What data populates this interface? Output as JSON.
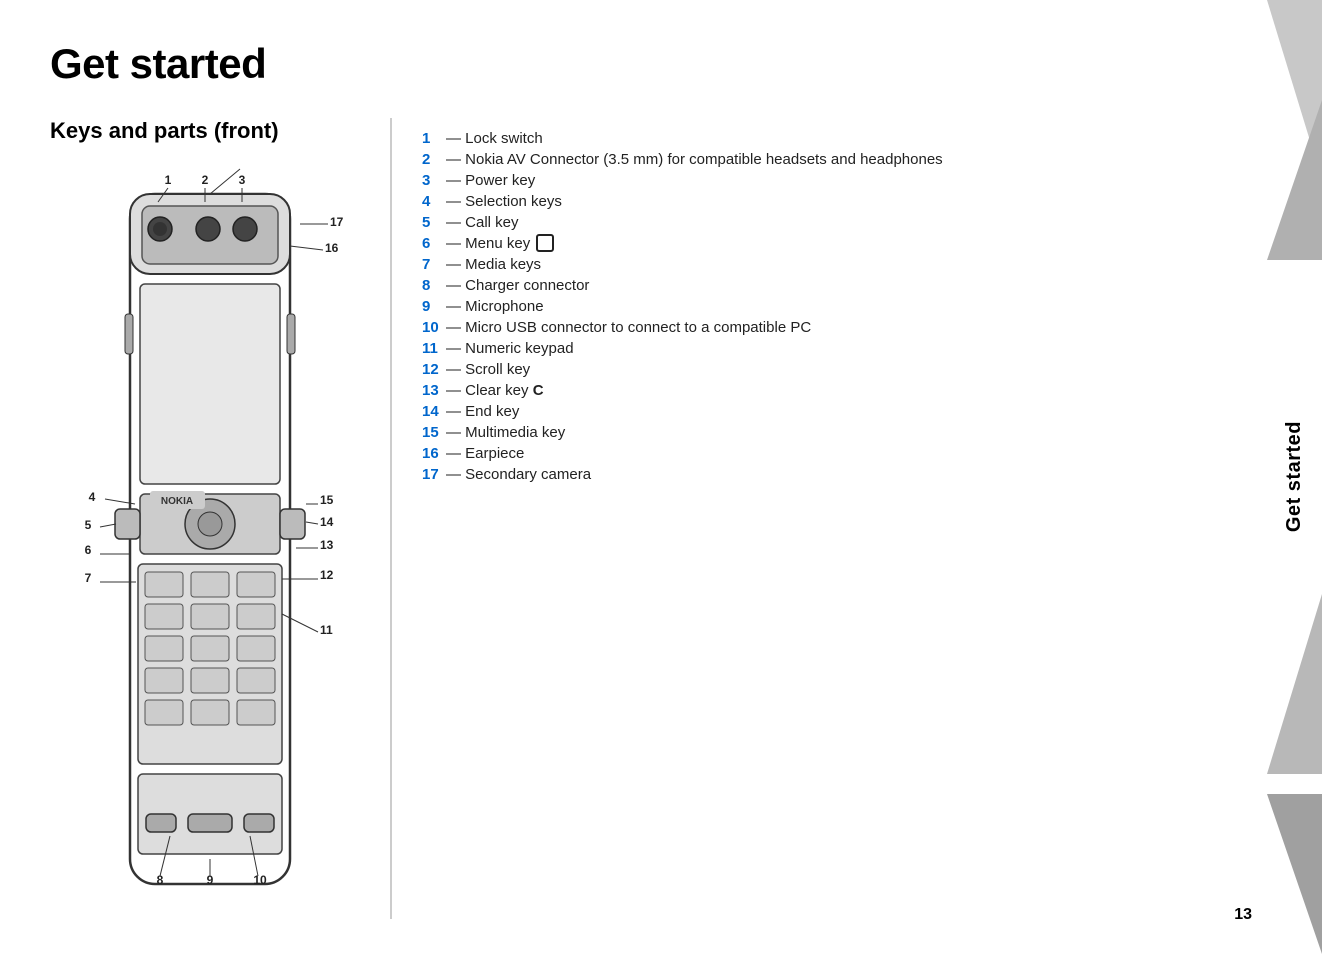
{
  "page": {
    "title": "Get started",
    "section_title": "Keys and parts (front)",
    "page_number": "13",
    "sidebar_label": "Get started"
  },
  "legend": [
    {
      "number": "1",
      "text": "— Lock switch"
    },
    {
      "number": "2",
      "text": "— Nokia AV Connector (3.5 mm) for compatible headsets and headphones"
    },
    {
      "number": "3",
      "text": "— Power key"
    },
    {
      "number": "4",
      "text": "— Selection keys"
    },
    {
      "number": "5",
      "text": "— Call key"
    },
    {
      "number": "6",
      "text": "— Menu key",
      "has_icon": true
    },
    {
      "number": "7",
      "text": "— Media keys"
    },
    {
      "number": "8",
      "text": "— Charger connector"
    },
    {
      "number": "9",
      "text": "— Microphone"
    },
    {
      "number": "10",
      "text": "— Micro USB connector to connect to a compatible PC"
    },
    {
      "number": "11",
      "text": "— Numeric keypad"
    },
    {
      "number": "12",
      "text": "— Scroll key"
    },
    {
      "number": "13",
      "text": "— Clear key",
      "bold_suffix": "C"
    },
    {
      "number": "14",
      "text": "— End key"
    },
    {
      "number": "15",
      "text": "— Multimedia key"
    },
    {
      "number": "16",
      "text": "— Earpiece"
    },
    {
      "number": "17",
      "text": "— Secondary camera"
    }
  ],
  "diagram": {
    "labels": [
      "1",
      "2",
      "3",
      "4",
      "5",
      "6",
      "7",
      "8",
      "9",
      "10",
      "11",
      "12",
      "13",
      "14",
      "15",
      "16",
      "17"
    ]
  }
}
